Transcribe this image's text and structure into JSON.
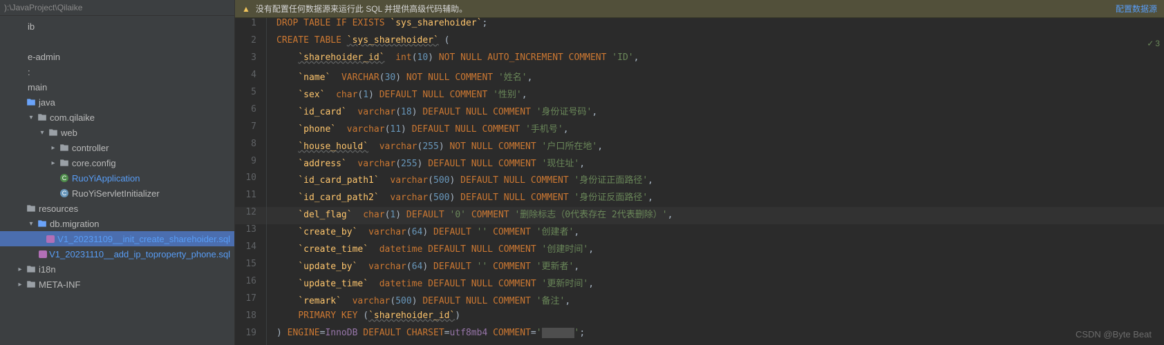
{
  "breadcrumb": "):\\JavaProject\\Qilaike",
  "tree": [
    {
      "indent": 0,
      "chev": "",
      "icon": "",
      "label": "ib",
      "link": false
    },
    {
      "indent": 0,
      "chev": "",
      "icon": "",
      "label": "",
      "link": false
    },
    {
      "indent": 0,
      "chev": "",
      "icon": "",
      "label": "e-admin",
      "link": false
    },
    {
      "indent": 0,
      "chev": "",
      "icon": "",
      "label": ":",
      "link": false
    },
    {
      "indent": 0,
      "chev": "",
      "icon": "",
      "label": "main",
      "link": false
    },
    {
      "indent": 1,
      "chev": "",
      "icon": "folder-blue",
      "label": "java",
      "link": false
    },
    {
      "indent": 2,
      "chev": "down",
      "icon": "folder",
      "label": "com.qilaike",
      "link": false
    },
    {
      "indent": 3,
      "chev": "down",
      "icon": "folder",
      "label": "web",
      "link": false
    },
    {
      "indent": 4,
      "chev": "right",
      "icon": "folder",
      "label": "controller",
      "link": false
    },
    {
      "indent": 4,
      "chev": "right",
      "icon": "folder",
      "label": "core.config",
      "link": false
    },
    {
      "indent": 4,
      "chev": "",
      "icon": "class",
      "label": "RuoYiApplication",
      "link": true
    },
    {
      "indent": 4,
      "chev": "",
      "icon": "circle",
      "label": "RuoYiServletInitializer",
      "link": false
    },
    {
      "indent": 1,
      "chev": "",
      "icon": "folder",
      "label": "resources",
      "link": false
    },
    {
      "indent": 2,
      "chev": "down",
      "icon": "folder-blue",
      "label": "db.migration",
      "link": false
    },
    {
      "indent": 3,
      "chev": "",
      "icon": "sql",
      "label": "V1_20231109__init_create_sharehoider.sql",
      "link": true,
      "selected": true
    },
    {
      "indent": 3,
      "chev": "",
      "icon": "sql",
      "label": "V1_20231110__add_ip_toproperty_phone.sql",
      "link": true
    },
    {
      "indent": 1,
      "chev": "right",
      "icon": "folder",
      "label": "i18n",
      "link": false
    },
    {
      "indent": 1,
      "chev": "right",
      "icon": "folder",
      "label": "META-INF",
      "link": false
    }
  ],
  "warning": {
    "text": "没有配置任何数据源来运行此 SQL 并提供高级代码辅助。",
    "config_link": "配置数据源"
  },
  "status_check": "3",
  "code_lines": [
    {
      "n": 1,
      "hl": false,
      "tokens": [
        [
          "kw",
          "DROP TABLE IF EXISTS"
        ],
        [
          "pn",
          " "
        ],
        [
          "id",
          "`sys_sharehoider`"
        ],
        [
          "pn",
          ";"
        ]
      ]
    },
    {
      "n": 2,
      "hl": false,
      "tokens": [
        [
          "kw",
          "CREATE TABLE"
        ],
        [
          "pn",
          " "
        ],
        [
          "id-u",
          "`sys_sharehoider`"
        ],
        [
          "pn",
          " ("
        ]
      ]
    },
    {
      "n": 3,
      "hl": false,
      "tokens": [
        [
          "pn",
          "    "
        ],
        [
          "id-u",
          "`sharehoider_id`"
        ],
        [
          "pn",
          "  "
        ],
        [
          "kw",
          "int"
        ],
        [
          "pn",
          "("
        ],
        [
          "num",
          "10"
        ],
        [
          "pn",
          ") "
        ],
        [
          "kw",
          "NOT NULL AUTO_INCREMENT COMMENT"
        ],
        [
          "pn",
          " "
        ],
        [
          "str",
          "'ID'"
        ],
        [
          "pn",
          ","
        ]
      ]
    },
    {
      "n": 4,
      "hl": false,
      "tokens": [
        [
          "pn",
          "    "
        ],
        [
          "id",
          "`name`"
        ],
        [
          "pn",
          "  "
        ],
        [
          "kw",
          "VARCHAR"
        ],
        [
          "pn",
          "("
        ],
        [
          "num",
          "30"
        ],
        [
          "pn",
          ") "
        ],
        [
          "kw",
          "NOT NULL COMMENT"
        ],
        [
          "pn",
          " "
        ],
        [
          "str",
          "'姓名'"
        ],
        [
          "pn",
          ","
        ]
      ]
    },
    {
      "n": 5,
      "hl": false,
      "tokens": [
        [
          "pn",
          "    "
        ],
        [
          "id",
          "`sex`"
        ],
        [
          "pn",
          "  "
        ],
        [
          "kw",
          "char"
        ],
        [
          "pn",
          "("
        ],
        [
          "num",
          "1"
        ],
        [
          "pn",
          ") "
        ],
        [
          "kw",
          "DEFAULT NULL COMMENT"
        ],
        [
          "pn",
          " "
        ],
        [
          "str",
          "'性别'"
        ],
        [
          "pn",
          ","
        ]
      ]
    },
    {
      "n": 6,
      "hl": false,
      "tokens": [
        [
          "pn",
          "    "
        ],
        [
          "id",
          "`id_card`"
        ],
        [
          "pn",
          "  "
        ],
        [
          "kw",
          "varchar"
        ],
        [
          "pn",
          "("
        ],
        [
          "num",
          "18"
        ],
        [
          "pn",
          ") "
        ],
        [
          "kw",
          "DEFAULT NULL COMMENT"
        ],
        [
          "pn",
          " "
        ],
        [
          "str",
          "'身份证号码'"
        ],
        [
          "pn",
          ","
        ]
      ]
    },
    {
      "n": 7,
      "hl": false,
      "tokens": [
        [
          "pn",
          "    "
        ],
        [
          "id",
          "`phone`"
        ],
        [
          "pn",
          "  "
        ],
        [
          "kw",
          "varchar"
        ],
        [
          "pn",
          "("
        ],
        [
          "num",
          "11"
        ],
        [
          "pn",
          ") "
        ],
        [
          "kw",
          "DEFAULT NULL COMMENT"
        ],
        [
          "pn",
          " "
        ],
        [
          "str",
          "'手机号'"
        ],
        [
          "pn",
          ","
        ]
      ]
    },
    {
      "n": 8,
      "hl": false,
      "tokens": [
        [
          "pn",
          "    "
        ],
        [
          "id-u",
          "`house_hould`"
        ],
        [
          "pn",
          "  "
        ],
        [
          "kw",
          "varchar"
        ],
        [
          "pn",
          "("
        ],
        [
          "num",
          "255"
        ],
        [
          "pn",
          ") "
        ],
        [
          "kw",
          "NOT NULL COMMENT"
        ],
        [
          "pn",
          " "
        ],
        [
          "str",
          "'户口所在地'"
        ],
        [
          "pn",
          ","
        ]
      ]
    },
    {
      "n": 9,
      "hl": false,
      "tokens": [
        [
          "pn",
          "    "
        ],
        [
          "id",
          "`address`"
        ],
        [
          "pn",
          "  "
        ],
        [
          "kw",
          "varchar"
        ],
        [
          "pn",
          "("
        ],
        [
          "num",
          "255"
        ],
        [
          "pn",
          ") "
        ],
        [
          "kw",
          "DEFAULT NULL COMMENT"
        ],
        [
          "pn",
          " "
        ],
        [
          "str",
          "'现住址'"
        ],
        [
          "pn",
          ","
        ]
      ]
    },
    {
      "n": 10,
      "hl": false,
      "tokens": [
        [
          "pn",
          "    "
        ],
        [
          "id",
          "`id_card_path1`"
        ],
        [
          "pn",
          "  "
        ],
        [
          "kw",
          "varchar"
        ],
        [
          "pn",
          "("
        ],
        [
          "num",
          "500"
        ],
        [
          "pn",
          ") "
        ],
        [
          "kw",
          "DEFAULT NULL COMMENT"
        ],
        [
          "pn",
          " "
        ],
        [
          "str",
          "'身份证正面路径'"
        ],
        [
          "pn",
          ","
        ]
      ]
    },
    {
      "n": 11,
      "hl": false,
      "tokens": [
        [
          "pn",
          "    "
        ],
        [
          "id",
          "`id_card_path2`"
        ],
        [
          "pn",
          "  "
        ],
        [
          "kw",
          "varchar"
        ],
        [
          "pn",
          "("
        ],
        [
          "num",
          "500"
        ],
        [
          "pn",
          ") "
        ],
        [
          "kw",
          "DEFAULT NULL COMMENT"
        ],
        [
          "pn",
          " "
        ],
        [
          "str",
          "'身份证反面路径'"
        ],
        [
          "pn",
          ","
        ]
      ]
    },
    {
      "n": 12,
      "hl": true,
      "tokens": [
        [
          "pn",
          "    "
        ],
        [
          "id",
          "`del_flag`"
        ],
        [
          "pn",
          "  "
        ],
        [
          "kw",
          "char"
        ],
        [
          "pn",
          "("
        ],
        [
          "num",
          "1"
        ],
        [
          "pn",
          ") "
        ],
        [
          "kw",
          "DEFAULT"
        ],
        [
          "pn",
          " "
        ],
        [
          "str",
          "'0'"
        ],
        [
          "pn",
          " "
        ],
        [
          "kw",
          "COMMENT"
        ],
        [
          "pn",
          " "
        ],
        [
          "str",
          "'删除标志（0代表存在 2代表删除）'"
        ],
        [
          "pn",
          ","
        ]
      ]
    },
    {
      "n": 13,
      "hl": false,
      "tokens": [
        [
          "pn",
          "    "
        ],
        [
          "id",
          "`create_by`"
        ],
        [
          "pn",
          "  "
        ],
        [
          "kw",
          "varchar"
        ],
        [
          "pn",
          "("
        ],
        [
          "num",
          "64"
        ],
        [
          "pn",
          ") "
        ],
        [
          "kw",
          "DEFAULT"
        ],
        [
          "pn",
          " "
        ],
        [
          "str",
          "''"
        ],
        [
          "pn",
          " "
        ],
        [
          "kw",
          "COMMENT"
        ],
        [
          "pn",
          " "
        ],
        [
          "str",
          "'创建者'"
        ],
        [
          "pn",
          ","
        ]
      ]
    },
    {
      "n": 14,
      "hl": false,
      "tokens": [
        [
          "pn",
          "    "
        ],
        [
          "id",
          "`create_time`"
        ],
        [
          "pn",
          "  "
        ],
        [
          "kw",
          "datetime DEFAULT NULL COMMENT"
        ],
        [
          "pn",
          " "
        ],
        [
          "str",
          "'创建时间'"
        ],
        [
          "pn",
          ","
        ]
      ]
    },
    {
      "n": 15,
      "hl": false,
      "tokens": [
        [
          "pn",
          "    "
        ],
        [
          "id",
          "`update_by`"
        ],
        [
          "pn",
          "  "
        ],
        [
          "kw",
          "varchar"
        ],
        [
          "pn",
          "("
        ],
        [
          "num",
          "64"
        ],
        [
          "pn",
          ") "
        ],
        [
          "kw",
          "DEFAULT"
        ],
        [
          "pn",
          " "
        ],
        [
          "str",
          "''"
        ],
        [
          "pn",
          " "
        ],
        [
          "kw",
          "COMMENT"
        ],
        [
          "pn",
          " "
        ],
        [
          "str",
          "'更新者'"
        ],
        [
          "pn",
          ","
        ]
      ]
    },
    {
      "n": 16,
      "hl": false,
      "tokens": [
        [
          "pn",
          "    "
        ],
        [
          "id",
          "`update_time`"
        ],
        [
          "pn",
          "  "
        ],
        [
          "kw",
          "datetime DEFAULT NULL COMMENT"
        ],
        [
          "pn",
          " "
        ],
        [
          "str",
          "'更新时间'"
        ],
        [
          "pn",
          ","
        ]
      ]
    },
    {
      "n": 17,
      "hl": false,
      "tokens": [
        [
          "pn",
          "    "
        ],
        [
          "id",
          "`remark`"
        ],
        [
          "pn",
          "  "
        ],
        [
          "kw",
          "varchar"
        ],
        [
          "pn",
          "("
        ],
        [
          "num",
          "500"
        ],
        [
          "pn",
          ") "
        ],
        [
          "kw",
          "DEFAULT NULL COMMENT"
        ],
        [
          "pn",
          " "
        ],
        [
          "str",
          "'备注'"
        ],
        [
          "pn",
          ","
        ]
      ]
    },
    {
      "n": 18,
      "hl": false,
      "tokens": [
        [
          "pn",
          "    "
        ],
        [
          "kw",
          "PRIMARY KEY"
        ],
        [
          "pn",
          " ("
        ],
        [
          "id-u",
          "`sharehoider_id`"
        ],
        [
          "pn",
          ")"
        ]
      ]
    },
    {
      "n": 19,
      "hl": false,
      "tokens": [
        [
          "pn",
          ") "
        ],
        [
          "kw",
          "ENGINE"
        ],
        [
          "pn",
          "="
        ],
        [
          "ident",
          "InnoDB"
        ],
        [
          "pn",
          " "
        ],
        [
          "kw",
          "DEFAULT CHARSET"
        ],
        [
          "pn",
          "="
        ],
        [
          "ident",
          "utf8mb4"
        ],
        [
          "pn",
          " "
        ],
        [
          "kw",
          "COMMENT"
        ],
        [
          "pn",
          "="
        ],
        [
          "str",
          "'"
        ],
        [
          "mask",
          "      "
        ],
        [
          "str",
          "'"
        ],
        [
          "pn",
          ";"
        ]
      ]
    }
  ],
  "watermark": "CSDN @Byte Beat"
}
